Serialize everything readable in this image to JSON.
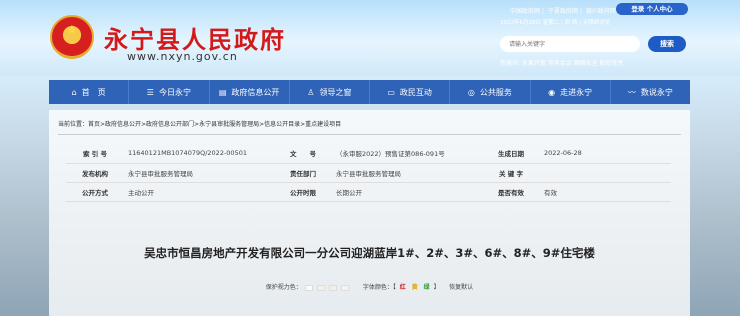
{
  "header": {
    "site_title": "永宁县人民政府",
    "site_url": "www.nxyn.gov.cn",
    "top_links": [
      "中国政府网",
      "宁夏政府网",
      "银川政府网"
    ],
    "login_label": "登录 个人中心",
    "date_line": "2022年6月28日 星期二 | 阴 晴 | 无障碍浏览",
    "search_placeholder": "请输入关键字",
    "search_button": "搜索",
    "hot_words": "热搜词: 水果开放 常务会议 网络安全 职权任免"
  },
  "nav": {
    "items": [
      {
        "icon": "home-icon",
        "glyph": "⌂",
        "label": "首　页"
      },
      {
        "icon": "list-icon",
        "glyph": "☰",
        "label": "今日永宁"
      },
      {
        "icon": "document-icon",
        "glyph": "▤",
        "label": "政府信息公开"
      },
      {
        "icon": "person-icon",
        "glyph": "♙",
        "label": "领导之窗"
      },
      {
        "icon": "chat-icon",
        "glyph": "▭",
        "label": "政民互动"
      },
      {
        "icon": "compass-icon",
        "glyph": "◎",
        "label": "公共服务"
      },
      {
        "icon": "location-icon",
        "glyph": "◉",
        "label": "走进永宁"
      },
      {
        "icon": "chart-icon",
        "glyph": "〰",
        "label": "数说永宁"
      }
    ]
  },
  "breadcrumb": "当前位置：首页>政府信息公开>政府信息公开部门>永宁县审批服务管理局>信息公开目录>重点建设项目",
  "meta": {
    "index_no_label": "索 引 号",
    "index_no": "11640121MB1074079Q/2022-00501",
    "doc_no_label": "文　　号",
    "doc_no": "（永审服2022）预售证第086-091号",
    "date_label": "生成日期",
    "date": "2022-06-28",
    "publisher_label": "发布机构",
    "publisher": "永宁县审批服务管理局",
    "dept_label": "责任部门",
    "dept": "永宁县审批服务管理局",
    "keyword_label": "关 键 字",
    "keyword": "",
    "method_label": "公开方式",
    "method": "主动公开",
    "period_label": "公开时限",
    "period": "长期公开",
    "valid_label": "是否有效",
    "valid": "有效"
  },
  "article": {
    "title": "吴忠市恒昌房地产开发有限公司一分公司迎湖蓝岸1#、2#、3#、6#、8#、9#住宅楼"
  },
  "options": {
    "eye_label": "保护视力色：",
    "eye_colors": [
      "#fafafa",
      "#eef5e8",
      "#f3efe4",
      "#f7f2f7"
    ],
    "font_color_label": "字体颜色：【",
    "font_colors": [
      {
        "label": "红",
        "color": "#d21a1a"
      },
      {
        "label": "黄",
        "color": "#e3a600"
      },
      {
        "label": "绿",
        "color": "#2a9b2a"
      }
    ],
    "font_color_end": "】",
    "restore_label": "恢复默认"
  }
}
